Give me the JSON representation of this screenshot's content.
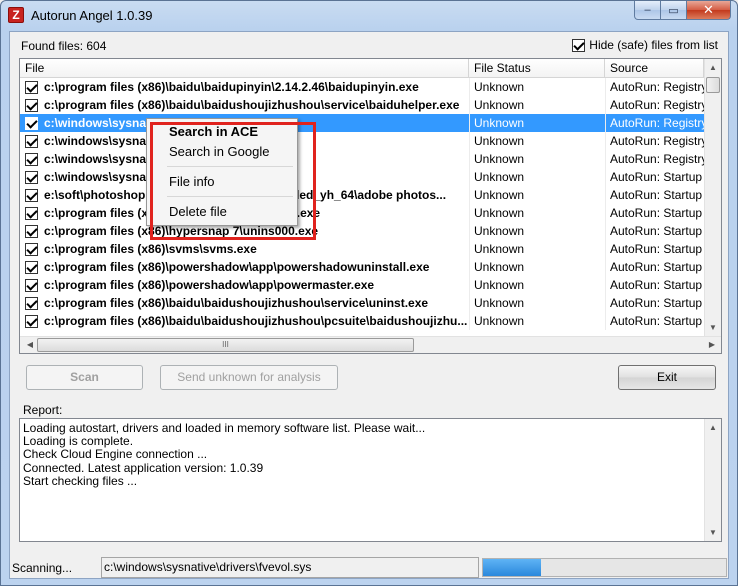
{
  "window": {
    "title": "Autorun Angel 1.0.39"
  },
  "caption": {
    "minimize": "‒",
    "maximize": "▭",
    "close": "✕"
  },
  "found_files": "Found files: 604",
  "hide_safe": {
    "label": "Hide (safe) files from list",
    "checked": true
  },
  "list": {
    "columns": [
      "File",
      "File Status",
      "Source"
    ],
    "rows": [
      {
        "path": "c:\\program files (x86)\\baidu\\baidupinyin\\2.14.2.46\\baidupinyin.exe",
        "status": "Unknown",
        "source": "AutoRun: Registry"
      },
      {
        "path": "c:\\program files (x86)\\baidu\\baidushoujizhushou\\service\\baiduhelper.exe",
        "status": "Unknown",
        "source": "AutoRun: Registry"
      },
      {
        "path": "c:\\windows\\sysnative\\iertutil.dll",
        "status": "Unknown",
        "source": "AutoRun: Registry",
        "selected": true
      },
      {
        "path": "c:\\windows\\sysnative\\imageres.dll",
        "status": "Unknown",
        "source": "AutoRun: Registry"
      },
      {
        "path": "c:\\windows\\sysnative\\wbem\\wbemcomn.dll",
        "status": "Unknown",
        "source": "AutoRun: Registry"
      },
      {
        "path": "c:\\windows\\sysnative\\drivers\\tdx.sys",
        "status": "Unknown",
        "source": "AutoRun: Startup f"
      },
      {
        "path": "e:\\soft\\photoshop cs6\\photoshop cs6 extended_yh_64\\adobe photos...",
        "status": "Unknown",
        "source": "AutoRun: Startup f"
      },
      {
        "path": "c:\\program files (x86)\\hypersnap 7\\hprsnap7.exe",
        "status": "Unknown",
        "source": "AutoRun: Startup f"
      },
      {
        "path": "c:\\program files (x86)\\hypersnap 7\\unins000.exe",
        "status": "Unknown",
        "source": "AutoRun: Startup f"
      },
      {
        "path": "c:\\program files (x86)\\svms\\svms.exe",
        "status": "Unknown",
        "source": "AutoRun: Startup f"
      },
      {
        "path": "c:\\program files (x86)\\powershadow\\app\\powershadowuninstall.exe",
        "status": "Unknown",
        "source": "AutoRun: Startup f"
      },
      {
        "path": "c:\\program files (x86)\\powershadow\\app\\powermaster.exe",
        "status": "Unknown",
        "source": "AutoRun: Startup f"
      },
      {
        "path": "c:\\program files (x86)\\baidu\\baidushoujizhushou\\service\\uninst.exe",
        "status": "Unknown",
        "source": "AutoRun: Startup f"
      },
      {
        "path": "c:\\program files (x86)\\baidu\\baidushoujizhushou\\pcsuite\\baidushoujizhu...",
        "status": "Unknown",
        "source": "AutoRun: Startup f"
      }
    ],
    "scroll_thumb_grip": "III"
  },
  "buttons": {
    "scan": "Scan",
    "send": "Send unknown for analysis",
    "exit": "Exit"
  },
  "report": {
    "label": "Report:",
    "lines": [
      "Loading autostart, drivers and loaded in memory software list. Please wait...",
      "Loading is complete.",
      "Check Cloud Engine connection ...",
      "Connected. Latest application version: 1.0.39",
      "Start checking files ..."
    ]
  },
  "status": {
    "text": "Scanning...",
    "current_file": "c:\\windows\\sysnative\\drivers\\fvevol.sys",
    "progress_fraction": 0.24
  },
  "context_menu": {
    "items": [
      "Search in ACE",
      "Search in Google",
      "File info",
      "Delete file"
    ]
  },
  "colors": {
    "selection": "#3399ff",
    "highlight_box": "#e0231e",
    "progress": "#2a88dc"
  }
}
